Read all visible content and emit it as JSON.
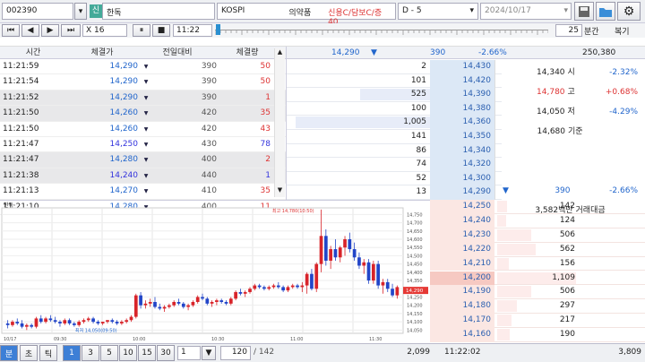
{
  "header": {
    "code": "002390",
    "name_icon": "신",
    "name": "한독",
    "market": "KOSPI",
    "sector": "의약품",
    "credit": "신용C/담보C/증40",
    "range": "D - 5",
    "date": "2024/10/17"
  },
  "controls": {
    "speed": "X 16",
    "time": "11:22",
    "period": "25",
    "period_unit": "분간",
    "replay_label": "복기"
  },
  "trades": {
    "headers": [
      "시간",
      "체결가",
      "전일대비",
      "체결량"
    ],
    "rows": [
      {
        "t": "11:21:59",
        "p": "14,290",
        "d": "390",
        "v": "50",
        "c": "up",
        "alt": false
      },
      {
        "t": "11:21:54",
        "p": "14,290",
        "d": "390",
        "v": "50",
        "c": "up",
        "alt": false
      },
      {
        "t": "11:21:52",
        "p": "14,290",
        "d": "390",
        "v": "1",
        "c": "up",
        "alt": true
      },
      {
        "t": "11:21:50",
        "p": "14,260",
        "d": "420",
        "v": "35",
        "c": "up",
        "alt": true
      },
      {
        "t": "11:21:50",
        "p": "14,260",
        "d": "420",
        "v": "43",
        "c": "up",
        "alt": false
      },
      {
        "t": "11:21:47",
        "p": "14,250",
        "d": "430",
        "v": "78",
        "c": "bl",
        "alt": false
      },
      {
        "t": "11:21:47",
        "p": "14,280",
        "d": "400",
        "v": "2",
        "c": "up",
        "alt": true
      },
      {
        "t": "11:21:38",
        "p": "14,240",
        "d": "440",
        "v": "1",
        "c": "bl",
        "alt": true
      },
      {
        "t": "11:21:13",
        "p": "14,270",
        "d": "410",
        "v": "35",
        "c": "up",
        "alt": false
      },
      {
        "t": "11:21:10",
        "p": "14,280",
        "d": "400",
        "v": "11",
        "c": "up",
        "alt": false
      }
    ]
  },
  "ob_header": {
    "price": "14,290",
    "diff": "390",
    "pct": "-2.66%",
    "volume": "250,380"
  },
  "asks": [
    {
      "q": "2",
      "p": "14,430",
      "w": 0
    },
    {
      "q": "101",
      "p": "14,420",
      "w": 0
    },
    {
      "q": "525",
      "p": "14,390",
      "w": 0.52
    },
    {
      "q": "100",
      "p": "14,380",
      "w": 0
    },
    {
      "q": "1,005",
      "p": "14,360",
      "w": 1
    },
    {
      "q": "141",
      "p": "14,350",
      "w": 0
    },
    {
      "q": "86",
      "p": "14,340",
      "w": 0
    },
    {
      "q": "74",
      "p": "14,320",
      "w": 0
    },
    {
      "q": "52",
      "p": "14,300",
      "w": 0
    },
    {
      "q": "13",
      "p": "14,290",
      "w": 0
    }
  ],
  "bids": [
    {
      "p": "14,250",
      "q": "142",
      "w": 0.07
    },
    {
      "p": "14,240",
      "q": "124",
      "w": 0.06
    },
    {
      "p": "14,230",
      "q": "506",
      "w": 0.24
    },
    {
      "p": "14,220",
      "q": "562",
      "w": 0.27
    },
    {
      "p": "14,210",
      "q": "156",
      "w": 0.08
    },
    {
      "p": "14,200",
      "q": "1,109",
      "w": 0.55
    },
    {
      "p": "14,190",
      "q": "506",
      "w": 0.24
    },
    {
      "p": "14,180",
      "q": "297",
      "w": 0.14
    },
    {
      "p": "14,170",
      "q": "217",
      "w": 0.1
    },
    {
      "p": "14,160",
      "q": "190",
      "w": 0.09
    }
  ],
  "info": {
    "open_v": "14,340",
    "open_l": "시",
    "open_p": "-2.32%",
    "high_v": "14,780",
    "high_l": "고",
    "high_p": "+0.68%",
    "low_v": "14,050",
    "low_l": "저",
    "low_p": "-4.29%",
    "base_v": "14,680",
    "base_l": "기준",
    "ch": "390",
    "ch_p": "-2.66%",
    "amount": "3,582백만 거래대금"
  },
  "chart": {
    "name": "한독",
    "high_label": "최고 14,780(10:50)",
    "low_label": "최저 14,050(09:50)",
    "date": "10/17",
    "ticks": [
      "14,750",
      "14,700",
      "14,650",
      "14,600",
      "14,550",
      "14,500",
      "14,450",
      "14,400",
      "14,350",
      "14,300",
      "14,250",
      "14,200",
      "14,150",
      "14,100",
      "14,050"
    ],
    "times": [
      "09:30",
      "10:00",
      "10:30",
      "11:00",
      "11:30"
    ],
    "last_price": "14,290",
    "colors": {
      "up": "#d8242a",
      "down": "#2245c8"
    },
    "candles": [
      [
        14090,
        14110,
        14060,
        14080
      ],
      [
        14080,
        14110,
        14070,
        14100
      ],
      [
        14100,
        14120,
        14080,
        14090
      ],
      [
        14090,
        14110,
        14060,
        14070
      ],
      [
        14070,
        14090,
        14050,
        14080
      ],
      [
        14080,
        14090,
        14060,
        14070
      ],
      [
        14070,
        14130,
        14060,
        14120
      ],
      [
        14120,
        14140,
        14090,
        14100
      ],
      [
        14100,
        14130,
        14090,
        14120
      ],
      [
        14120,
        14140,
        14100,
        14110
      ],
      [
        14110,
        14130,
        14090,
        14100
      ],
      [
        14100,
        14110,
        14070,
        14090
      ],
      [
        14090,
        14120,
        14080,
        14110
      ],
      [
        14110,
        14120,
        14080,
        14090
      ],
      [
        14090,
        14100,
        14070,
        14080
      ],
      [
        14080,
        14110,
        14070,
        14100
      ],
      [
        14100,
        14120,
        14090,
        14110
      ],
      [
        14110,
        14130,
        14100,
        14120
      ],
      [
        14120,
        14130,
        14090,
        14100
      ],
      [
        14100,
        14110,
        14080,
        14090
      ],
      [
        14090,
        14100,
        14080,
        14100
      ],
      [
        14100,
        14110,
        14090,
        14110
      ],
      [
        14110,
        14120,
        14090,
        14100
      ],
      [
        14100,
        14110,
        14080,
        14090
      ],
      [
        14090,
        14110,
        14080,
        14100
      ],
      [
        14100,
        14120,
        14090,
        14110
      ],
      [
        14110,
        14140,
        14100,
        14130
      ],
      [
        14130,
        14270,
        14120,
        14260
      ],
      [
        14260,
        14280,
        14180,
        14200
      ],
      [
        14200,
        14230,
        14180,
        14210
      ],
      [
        14210,
        14240,
        14190,
        14220
      ],
      [
        14220,
        14250,
        14180,
        14190
      ],
      [
        14190,
        14210,
        14170,
        14180
      ],
      [
        14180,
        14200,
        14160,
        14190
      ],
      [
        14190,
        14210,
        14180,
        14200
      ],
      [
        14200,
        14230,
        14190,
        14220
      ],
      [
        14220,
        14240,
        14200,
        14210
      ],
      [
        14210,
        14220,
        14180,
        14190
      ],
      [
        14190,
        14210,
        14170,
        14200
      ],
      [
        14200,
        14230,
        14190,
        14220
      ],
      [
        14220,
        14260,
        14210,
        14250
      ],
      [
        14250,
        14270,
        14230,
        14240
      ],
      [
        14240,
        14250,
        14200,
        14210
      ],
      [
        14210,
        14230,
        14190,
        14220
      ],
      [
        14220,
        14240,
        14200,
        14230
      ],
      [
        14230,
        14240,
        14210,
        14220
      ],
      [
        14220,
        14230,
        14200,
        14210
      ],
      [
        14210,
        14250,
        14200,
        14240
      ],
      [
        14240,
        14290,
        14230,
        14280
      ],
      [
        14280,
        14300,
        14260,
        14270
      ],
      [
        14270,
        14290,
        14250,
        14280
      ],
      [
        14280,
        14310,
        14270,
        14300
      ],
      [
        14300,
        14330,
        14290,
        14320
      ],
      [
        14320,
        14330,
        14300,
        14310
      ],
      [
        14310,
        14320,
        14290,
        14300
      ],
      [
        14300,
        14320,
        14290,
        14310
      ],
      [
        14310,
        14330,
        14300,
        14320
      ],
      [
        14320,
        14340,
        14300,
        14310
      ],
      [
        14310,
        14320,
        14280,
        14290
      ],
      [
        14290,
        14320,
        14280,
        14310
      ],
      [
        14310,
        14330,
        14300,
        14320
      ],
      [
        14320,
        14330,
        14300,
        14310
      ],
      [
        14310,
        14340,
        14280,
        14320
      ],
      [
        14320,
        14400,
        14270,
        14390
      ],
      [
        14390,
        14420,
        14290,
        14300
      ],
      [
        14300,
        14460,
        14280,
        14450
      ],
      [
        14450,
        14780,
        14400,
        14620
      ],
      [
        14620,
        14660,
        14440,
        14470
      ],
      [
        14470,
        14560,
        14420,
        14540
      ],
      [
        14540,
        14600,
        14470,
        14490
      ],
      [
        14490,
        14560,
        14460,
        14550
      ],
      [
        14550,
        14620,
        14500,
        14600
      ],
      [
        14600,
        14640,
        14520,
        14540
      ],
      [
        14540,
        14580,
        14470,
        14490
      ],
      [
        14490,
        14520,
        14420,
        14440
      ],
      [
        14440,
        14480,
        14390,
        14460
      ],
      [
        14460,
        14480,
        14330,
        14350
      ],
      [
        14350,
        14470,
        14330,
        14450
      ],
      [
        14450,
        14470,
        14300,
        14320
      ],
      [
        14320,
        14360,
        14270,
        14340
      ],
      [
        14340,
        14360,
        14280,
        14300
      ],
      [
        14300,
        14330,
        14250,
        14260
      ],
      [
        14260,
        14320,
        14240,
        14310
      ]
    ]
  },
  "bottom": {
    "tabs": [
      "분",
      "초",
      "틱"
    ],
    "units": [
      "1",
      "3",
      "5",
      "10",
      "15",
      "30"
    ],
    "count": "1",
    "page": "120",
    "total": "/ 142",
    "sell_total": "2,099",
    "time": "11:22:02",
    "buy_total": "3,809"
  }
}
